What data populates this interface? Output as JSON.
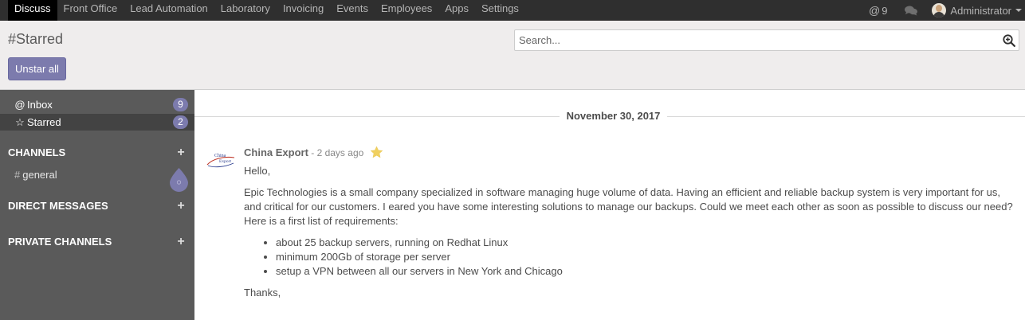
{
  "navbar": {
    "apps": [
      "Discuss",
      "Front Office",
      "Lead Automation",
      "Laboratory",
      "Invoicing",
      "Events",
      "Employees",
      "Apps",
      "Settings"
    ],
    "active_app": "Discuss",
    "mention_count": "9",
    "user_name": "Administrator",
    "icons": {
      "mentions": "at-icon",
      "chat": "comments-icon",
      "user_menu": "caret-down-icon"
    }
  },
  "control_panel": {
    "title": "#Starred",
    "unstar_all_label": "Unstar all",
    "search_placeholder": "Search...",
    "search_icon": "search-plus-icon"
  },
  "sidebar": {
    "mailboxes": [
      {
        "icon": "@",
        "label": "Inbox",
        "count": "9"
      },
      {
        "icon": "☆",
        "label": "Starred",
        "count": "2"
      }
    ],
    "sections": {
      "channels": "CHANNELS",
      "direct_messages": "DIRECT MESSAGES",
      "private_channels": "PRIVATE CHANNELS"
    },
    "add_label": "+",
    "channel_hash": "#",
    "channels": [
      "general"
    ]
  },
  "thread": {
    "date_separator": "November 30, 2017",
    "message": {
      "author": "China Export",
      "separator": " - ",
      "date": "2 days ago",
      "starred": true,
      "greeting": "Hello,",
      "paragraph": "Epic Technologies is a small company specialized in software managing huge volume of data. Having an efficient and reliable backup system is very important for us, and critical for our customers. I eared you have some interesting solutions to manage our backups. Could we meet each other as soon as possible to discuss our need? Here is a first list of requirements:",
      "requirements": [
        "about 25 backup servers, running on Redhat Linux",
        "minimum 200Gb of storage per server",
        "setup a VPN between all our servers in New York and Chicago"
      ],
      "closing": "Thanks,",
      "avatar_logo_lines": [
        "China",
        "Export"
      ]
    }
  },
  "colors": {
    "navbar_bg": "#2f2f2f",
    "accent": "#7c7bad",
    "sidebar_bg": "#5a5a5a",
    "sidebar_active": "#434343",
    "control_bg": "#efeded",
    "star": "#f0d060"
  }
}
